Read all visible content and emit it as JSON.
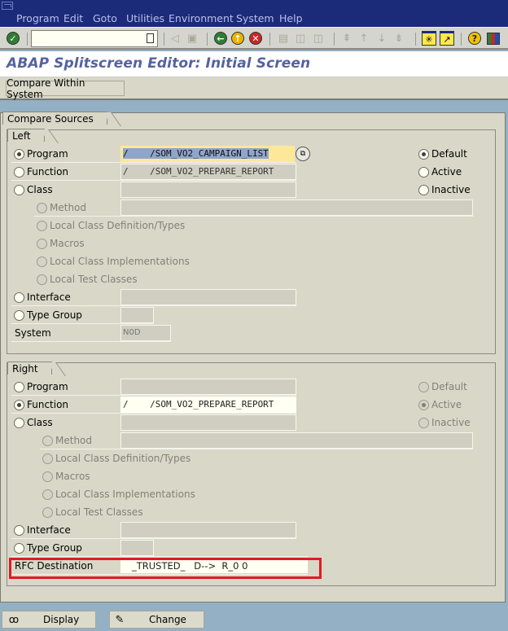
{
  "window": {
    "menu": [
      "Program",
      "Edit",
      "Goto",
      "Utilities",
      "Environment",
      "System",
      "Help"
    ]
  },
  "toolbar": {
    "command_field": {
      "value": "",
      "placeholder": ""
    },
    "icons": [
      "enter-icon",
      "back-icon",
      "save-icon",
      "back-green-icon",
      "exit-icon",
      "cancel-icon",
      "print-icon",
      "find-icon",
      "find-next-icon",
      "first-page-icon",
      "previous-page-icon",
      "next-page-icon",
      "last-page-icon",
      "create-session-icon",
      "create-shortcut-icon",
      "help-icon",
      "layout-menu-icon"
    ]
  },
  "page": {
    "title": "ABAP Splitscreen Editor: Initial Screen",
    "app_button": "Compare Within System"
  },
  "compare_sources": {
    "title": "Compare Sources",
    "left": {
      "title": "Left",
      "options": [
        {
          "label": "Program",
          "checked": true,
          "value": "/    /SOM_VO2_CAMPAIGN_LIST"
        },
        {
          "label": "Function",
          "checked": false,
          "value": "/    /SOM_VO2_PREPARE_REPORT"
        },
        {
          "label": "Class",
          "checked": false,
          "value": ""
        }
      ],
      "sub_options": [
        {
          "label": "Method",
          "value": ""
        },
        {
          "label": "Local Class Definition/Types"
        },
        {
          "label": "Macros"
        },
        {
          "label": "Local Class Implementations"
        },
        {
          "label": "Local Test Classes"
        }
      ],
      "interface": {
        "label": "Interface",
        "value": ""
      },
      "type_group": {
        "label": "Type Group",
        "value": ""
      },
      "system": {
        "label": "System",
        "value": "N0D"
      },
      "version": [
        {
          "label": "Default",
          "checked": true
        },
        {
          "label": "Active",
          "checked": false
        },
        {
          "label": "Inactive",
          "checked": false
        }
      ]
    },
    "right": {
      "title": "Right",
      "options": [
        {
          "label": "Program",
          "checked": false,
          "value": ""
        },
        {
          "label": "Function",
          "checked": true,
          "value": "/    /SOM_VO2_PREPARE_REPORT"
        },
        {
          "label": "Class",
          "checked": false,
          "value": ""
        }
      ],
      "sub_options": [
        {
          "label": "Method",
          "value": ""
        },
        {
          "label": "Local Class Definition/Types"
        },
        {
          "label": "Macros"
        },
        {
          "label": "Local Class Implementations"
        },
        {
          "label": "Local Test Classes"
        }
      ],
      "interface": {
        "label": "Interface",
        "value": ""
      },
      "type_group": {
        "label": "Type Group",
        "value": ""
      },
      "rfc_destination": {
        "label": "RFC Destination",
        "value": "   _TRUSTED_   D-->  R_0 0"
      },
      "version": [
        {
          "label": "Default",
          "checked": false
        },
        {
          "label": "Active",
          "checked": true
        },
        {
          "label": "Inactive",
          "checked": false
        }
      ]
    }
  },
  "footer": {
    "display_label": "Display",
    "change_label": "Change"
  },
  "colors": {
    "title_blue": "#5562a0",
    "titlebar": "#1c2a7a",
    "highlight_box": "#e01b22",
    "focus_field": "#fde89a"
  }
}
